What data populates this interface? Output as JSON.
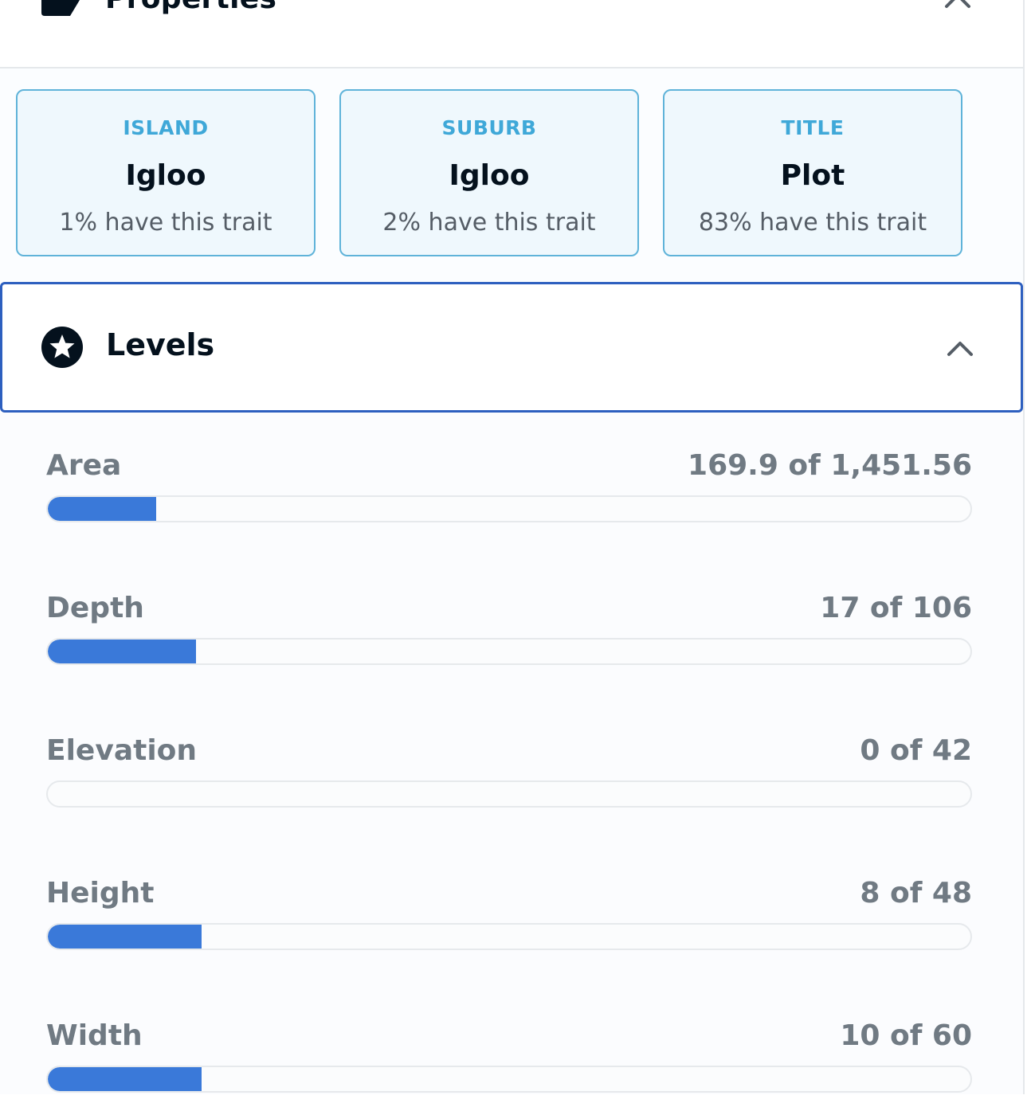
{
  "properties": {
    "title": "Properties",
    "traits": [
      {
        "type": "ISLAND",
        "value": "Igloo",
        "rarity": "1% have this trait"
      },
      {
        "type": "SUBURB",
        "value": "Igloo",
        "rarity": "2% have this trait"
      },
      {
        "type": "TITLE",
        "value": "Plot",
        "rarity": "83% have this trait"
      }
    ]
  },
  "levels": {
    "title": "Levels",
    "items": [
      {
        "name": "Area",
        "value_text": "169.9 of 1,451.56",
        "current": 169.9,
        "max": 1451.56
      },
      {
        "name": "Depth",
        "value_text": "17 of 106",
        "current": 17,
        "max": 106
      },
      {
        "name": "Elevation",
        "value_text": "0 of 42",
        "current": 0,
        "max": 42
      },
      {
        "name": "Height",
        "value_text": "8 of 48",
        "current": 8,
        "max": 48
      },
      {
        "name": "Width",
        "value_text": "10 of 60",
        "current": 10,
        "max": 60
      }
    ]
  },
  "colors": {
    "accent": "#2d5fbf",
    "bar_fill": "#3a79d9",
    "trait_border": "#5fb3d9",
    "trait_label": "#3fa8d8"
  },
  "icons": {
    "properties": "tag-icon",
    "levels": "star-circle-icon",
    "collapse": "chevron-up-icon"
  }
}
